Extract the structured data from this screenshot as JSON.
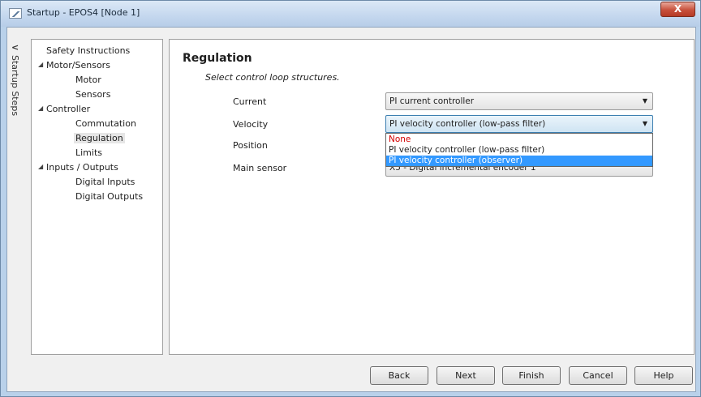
{
  "window": {
    "title": "Startup - EPOS4 [Node 1]",
    "close_label": "X"
  },
  "side": {
    "collapse_glyph": "<",
    "label": "Startup Steps"
  },
  "tree": {
    "items": [
      {
        "label": "Safety Instructions"
      },
      {
        "label": "Motor/Sensors"
      },
      {
        "label": "Motor"
      },
      {
        "label": "Sensors"
      },
      {
        "label": "Controller"
      },
      {
        "label": "Commutation"
      },
      {
        "label": "Regulation"
      },
      {
        "label": "Limits"
      },
      {
        "label": "Inputs / Outputs"
      },
      {
        "label": "Digital Inputs"
      },
      {
        "label": "Digital Outputs"
      }
    ],
    "expander_glyph": "◢"
  },
  "main": {
    "heading": "Regulation",
    "subheading": "Select control loop structures.",
    "rows": [
      {
        "label": "Current",
        "value": "PI current controller"
      },
      {
        "label": "Velocity",
        "value": "PI velocity controller (low-pass filter)"
      },
      {
        "label": "Position",
        "value": ""
      },
      {
        "label": "Main sensor",
        "value": "X5 - Digital incremental encoder 1"
      }
    ],
    "dropdown_arrow": "▼",
    "dropdown_options": [
      {
        "label": "None"
      },
      {
        "label": "PI velocity controller (low-pass filter)"
      },
      {
        "label": "PI velocity controller (observer)"
      }
    ]
  },
  "buttons": {
    "back": "Back",
    "next": "Next",
    "finish": "Finish",
    "cancel": "Cancel",
    "help": "Help"
  },
  "colors": {
    "highlight": "#3399ff",
    "none_option": "#d40000"
  }
}
